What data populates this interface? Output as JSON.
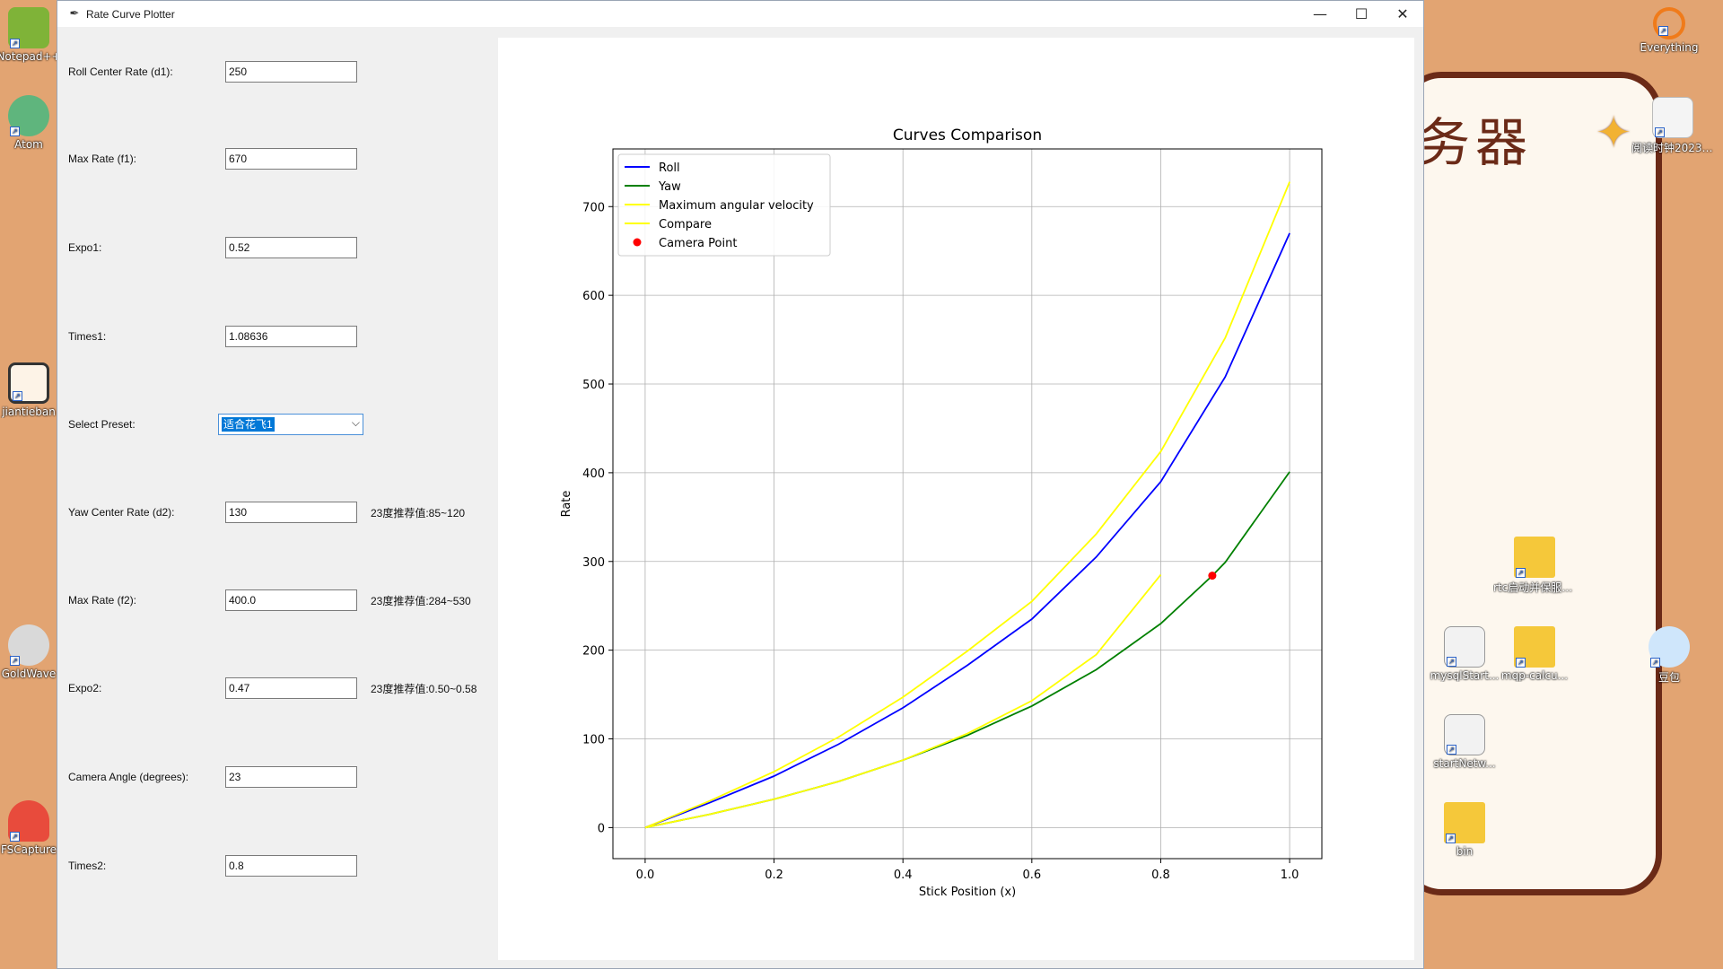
{
  "desktop": {
    "left_icons": [
      {
        "label": "Notepad++",
        "icon": "notepad-plus-plus-icon",
        "color": "#7fb338"
      },
      {
        "label": "Atom",
        "icon": "atom-icon",
        "color": "#5fb57d"
      },
      {
        "label": "jiantieban",
        "icon": "clipboard-app-icon",
        "color": "#fdf3e7"
      },
      {
        "label": "GoldWave",
        "icon": "goldwave-icon",
        "color": "#d9d9d9"
      },
      {
        "label": "FSCapture",
        "icon": "fscapture-icon",
        "color": "#e84b3c"
      }
    ],
    "right_icons": [
      {
        "label": "Everything",
        "icon": "everything-search-icon"
      },
      {
        "label": "阅读时钟2023112...",
        "icon": "python-file-icon"
      },
      {
        "label": "rtc启动并保服务器",
        "icon": "folder-icon"
      },
      {
        "label": "豆包",
        "icon": "doubao-icon"
      },
      {
        "label": "mysqlStart...",
        "icon": "settings-file-icon"
      },
      {
        "label": "mqp-calcu...",
        "icon": "folder-icon"
      },
      {
        "label": "startNetw...",
        "icon": "settings-file-icon"
      },
      {
        "label": "bin",
        "icon": "folder-icon"
      }
    ],
    "wallpaper_text": "务器"
  },
  "window": {
    "title": "Rate Curve Plotter",
    "minimize": "—",
    "maximize": "☐",
    "close": "✕"
  },
  "form": {
    "roll_center_rate": {
      "label": "Roll Center Rate (d1):",
      "value": "250"
    },
    "max_rate_f1": {
      "label": "Max Rate (f1):",
      "value": "670"
    },
    "expo1": {
      "label": "Expo1:",
      "value": "0.52"
    },
    "times1": {
      "label": "Times1:",
      "value": "1.08636"
    },
    "preset": {
      "label": "Select Preset:",
      "value": "适合花飞1"
    },
    "yaw_center_rate": {
      "label": "Yaw Center Rate (d2):",
      "value": "130",
      "hint": "23度推荐值:85~120"
    },
    "max_rate_f2": {
      "label": "Max Rate (f2):",
      "value": "400.0",
      "hint": "23度推荐值:284~530"
    },
    "expo2": {
      "label": "Expo2:",
      "value": "0.47",
      "hint": "23度推荐值:0.50~0.58"
    },
    "camera_angle": {
      "label": "Camera Angle (degrees):",
      "value": "23"
    },
    "times2": {
      "label": "Times2:",
      "value": "0.8"
    }
  },
  "chart_data": {
    "type": "line",
    "title": "Curves Comparison",
    "xlabel": "Stick Position (x)",
    "ylabel": "Rate",
    "xlim": [
      -0.05,
      1.05
    ],
    "ylim": [
      -35,
      765
    ],
    "xticks": [
      "0.0",
      "0.2",
      "0.4",
      "0.6",
      "0.8",
      "1.0"
    ],
    "yticks": [
      "0",
      "100",
      "200",
      "300",
      "400",
      "500",
      "600",
      "700"
    ],
    "grid": true,
    "legend_position": "upper-left",
    "series": [
      {
        "name": "Roll",
        "color": "#0000ff",
        "x": [
          0,
          0.1,
          0.2,
          0.3,
          0.4,
          0.5,
          0.6,
          0.7,
          0.8,
          0.9,
          1.0
        ],
        "y": [
          0,
          28,
          58,
          94,
          135,
          183,
          235,
          305,
          390,
          508,
          670
        ]
      },
      {
        "name": "Yaw",
        "color": "#008000",
        "x": [
          0,
          0.1,
          0.2,
          0.3,
          0.4,
          0.5,
          0.6,
          0.7,
          0.8,
          0.88,
          0.9,
          1.0
        ],
        "y": [
          0,
          15,
          32,
          52,
          76,
          104,
          137,
          178,
          230,
          284,
          299,
          401
        ]
      },
      {
        "name": "Maximum angular velocity",
        "color": "#ffff00",
        "x": [
          0,
          0.1,
          0.2,
          0.3,
          0.4,
          0.5,
          0.6,
          0.7,
          0.8,
          0.9,
          1.0
        ],
        "y": [
          0,
          30,
          63,
          102,
          147,
          199,
          255,
          331,
          424,
          552,
          728
        ]
      },
      {
        "name": "Compare",
        "color": "#ffff00",
        "x": [
          0,
          0.1,
          0.2,
          0.3,
          0.4,
          0.5,
          0.6,
          0.7,
          0.8
        ],
        "y": [
          0,
          15,
          32,
          52,
          76,
          106,
          143,
          195,
          285
        ]
      },
      {
        "name": "Camera Point",
        "color": "#ff0000",
        "marker": "circle",
        "x": [
          0.88
        ],
        "y": [
          284
        ]
      }
    ]
  }
}
